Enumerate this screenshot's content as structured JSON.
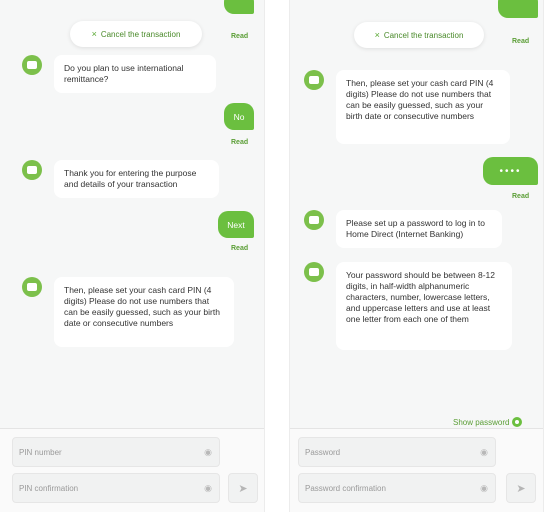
{
  "left": {
    "cancel_label": "Cancel the transaction",
    "messages": {
      "q_remittance": "Do you plan to use international remittance?",
      "a_no": "No",
      "thanks": "Thank you for entering the purpose and details of your transaction",
      "a_next": "Next",
      "pin_prompt": "Then, please set your cash card PIN (4 digits) Please do not use numbers that can be easily guessed, such as your birth date or consecutive numbers"
    },
    "read_label": "Read",
    "inputs": {
      "pin_placeholder": "PIN number",
      "pin_confirm_placeholder": "PIN confirmation"
    }
  },
  "right": {
    "cancel_label": "Cancel the transaction",
    "messages": {
      "pin_prompt": "Then, please set your cash card PIN (4 digits) Please do not use numbers that can be easily guessed, such as your birth date or consecutive numbers",
      "pin_masked": "••••",
      "password_request": "Please set up a password to log in to Home Direct (Internet Banking)",
      "password_rules": "Your password should be between 8-12 digits, in half-width alphanumeric characters, number, lowercase letters, and uppercase letters and use at least one letter from each one of them"
    },
    "read_label": "Read",
    "show_password_label": "Show password",
    "inputs": {
      "password_placeholder": "Password",
      "password_confirm_placeholder": "Password confirmation"
    }
  },
  "icons": {
    "cancel": "×",
    "eye": "◉",
    "send": "➤"
  },
  "colors": {
    "accent": "#6bbf3f",
    "accent_text": "#5b9e36",
    "bubble": "#ffffff",
    "background": "#f6f7f7"
  }
}
